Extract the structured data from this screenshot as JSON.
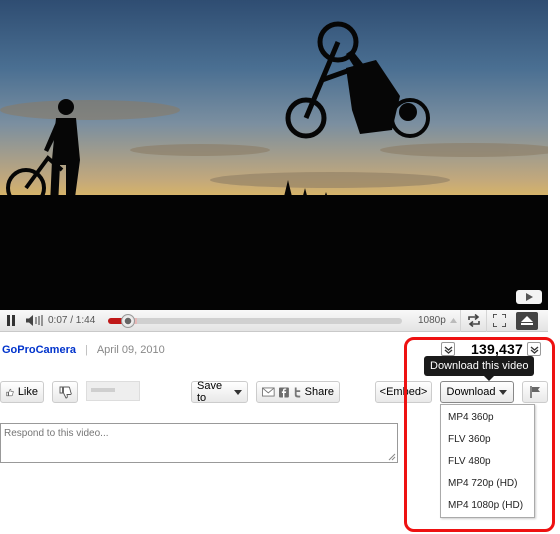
{
  "player": {
    "current_time": "0:07",
    "duration": "1:44",
    "time_display": "0:07 / 1:44",
    "progress_fraction": 0.067,
    "loaded_fraction": 0.1,
    "quality": "1080p"
  },
  "video_info": {
    "channel": "GoProCamera",
    "separator": "|",
    "date": "April 09, 2010",
    "view_count": "139,437"
  },
  "tooltip": {
    "text": "Download this video"
  },
  "actions": {
    "like_label": "Like",
    "save_to_label": "Save to",
    "share_label": "Share",
    "embed_label": "<Embed>",
    "download_label": "Download"
  },
  "comment": {
    "placeholder": "Respond to this video..."
  },
  "download_menu": {
    "options": [
      "MP4 360p",
      "FLV 360p",
      "FLV 480p",
      "MP4 720p (HD)",
      "MP4 1080p (HD)"
    ]
  },
  "colors": {
    "highlight": "#ee1111",
    "progress_played": "#c01818",
    "channel_link": "#0033cc"
  },
  "icons": {
    "pause": "pause-icon",
    "volume": "volume-icon",
    "loop": "loop-icon",
    "fullscreen": "fullscreen-icon",
    "eject": "eject-icon",
    "like": "thumbs-up-icon",
    "dislike": "thumbs-down-icon",
    "email": "email-icon",
    "facebook": "facebook-icon",
    "twitter": "twitter-icon",
    "flag": "flag-icon",
    "play": "play-icon"
  }
}
